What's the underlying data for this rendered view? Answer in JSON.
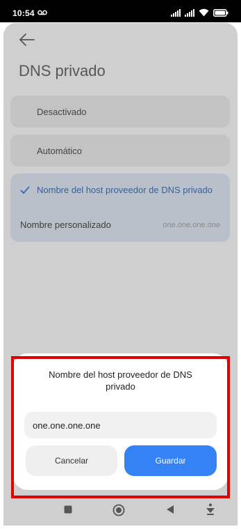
{
  "status_bar": {
    "time": "10:54",
    "voicemail_icon": "voicemail-icon",
    "icons": [
      "signal-icon",
      "signal-icon",
      "wifi-icon",
      "battery-icon"
    ]
  },
  "header": {
    "back_icon": "arrow-left-icon",
    "title": "DNS privado"
  },
  "options": [
    {
      "label": "Desactivado",
      "selected": false
    },
    {
      "label": "Automático",
      "selected": false
    },
    {
      "label": "Nombre del host proveedor de DNS privado",
      "selected": true
    }
  ],
  "custom": {
    "label": "Nombre personalizado",
    "value": "one.one.one.one"
  },
  "dialog": {
    "title": "Nombre del host proveedor de DNS privado",
    "input_value": "one.one.one.one",
    "cancel_label": "Cancelar",
    "save_label": "Guardar"
  },
  "nav_bar": {
    "icons": [
      "square-icon",
      "home-circle-icon",
      "back-triangle-icon",
      "download-arrow-icon"
    ]
  },
  "colors": {
    "accent": "#3582f5",
    "highlight": "#e00000"
  }
}
